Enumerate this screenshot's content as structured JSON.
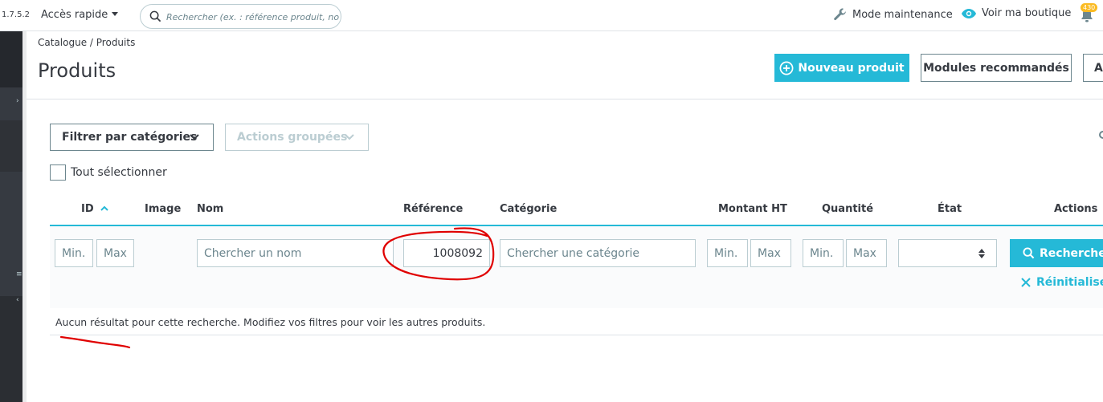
{
  "header": {
    "version": "1.7.5.2",
    "quick_access": "Accès rapide",
    "search_placeholder": "Rechercher (ex. : référence produit, nom",
    "maintenance": "Mode maintenance",
    "view_shop": "Voir ma boutique",
    "notifications_count": "430"
  },
  "breadcrumb": {
    "parent": "Catalogue",
    "separator": "/",
    "current": "Produits"
  },
  "page": {
    "title": "Produits"
  },
  "toolbar": {
    "new_product": "Nouveau produit",
    "recommended_modules": "Modules recommandés",
    "third_button_partial": "A"
  },
  "filters": {
    "by_category": "Filtrer par catégories",
    "bulk_actions": "Actions groupées",
    "select_all": "Tout sélectionner"
  },
  "table": {
    "columns": {
      "id": "ID",
      "image": "Image",
      "name": "Nom",
      "reference": "Référence",
      "category": "Catégorie",
      "price": "Montant HT",
      "quantity": "Quantité",
      "status": "État",
      "actions": "Actions"
    },
    "filter_inputs": {
      "id_min": "Min.",
      "id_max": "Max",
      "name_placeholder": "Chercher un nom",
      "reference_value": "1008092",
      "category_placeholder": "Chercher une catégorie",
      "price_min": "Min.",
      "price_max": "Max",
      "qty_min": "Min.",
      "qty_max": "Max",
      "status_selected": ""
    },
    "search_button": "Rechercher",
    "reset_button": "Réinitialiser",
    "empty_message": "Aucun résultat pour cette recherche. Modifiez vos filtres pour voir les autres produits."
  },
  "colors": {
    "accent": "#25b9d7",
    "text": "#363a41",
    "border": "#bbcdd2",
    "sidebar": "#363a41",
    "annotation": "#e00000",
    "badge": "#fbbb22"
  }
}
